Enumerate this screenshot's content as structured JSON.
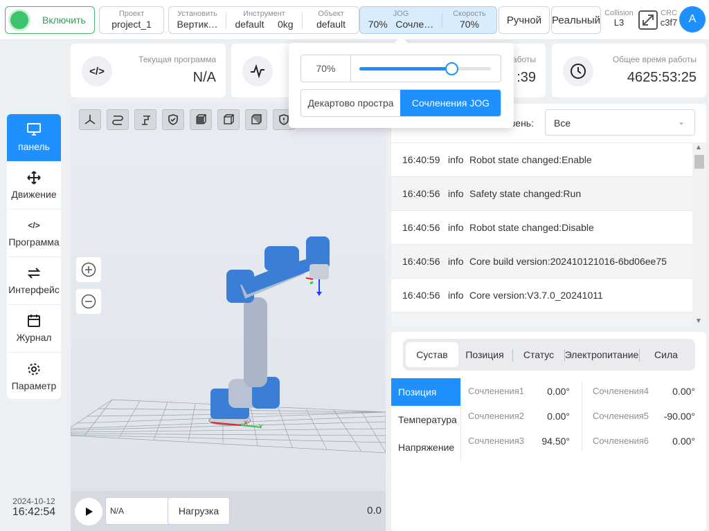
{
  "topbar": {
    "enable_label": "Включить",
    "project": {
      "label": "Проект",
      "value": "project_1"
    },
    "install": {
      "label": "Установить",
      "value": "Вертик…"
    },
    "tool": {
      "label": "Инструмент",
      "value": "default",
      "weight": "0kg"
    },
    "object": {
      "label": "Объект",
      "value": "default"
    },
    "jog": {
      "label": "JOG",
      "value": "70%",
      "mode": "Сочле…"
    },
    "speed": {
      "label": "Скорость",
      "value": "70%"
    },
    "manual_label": "Ручной",
    "real_label": "Реальный",
    "collision": {
      "label": "Collision",
      "value": "L3"
    },
    "crc": {
      "label": "CRC",
      "value": "c3f7"
    },
    "avatar_letter": "A"
  },
  "cards": {
    "program": {
      "icon": "</>",
      "title": "Текущая программа",
      "value": "N/A"
    },
    "runtime": {
      "title_fragment": "аботы",
      "value_fragment": ":39"
    },
    "total": {
      "title": "Общее время работы",
      "value": "4625:53:25"
    }
  },
  "sidebar": {
    "items": [
      {
        "label": "панель",
        "icon": "monitor-icon"
      },
      {
        "label": "Движение",
        "icon": "move-icon"
      },
      {
        "label": "Программа",
        "icon": "code-icon"
      },
      {
        "label": "Интерфейс",
        "icon": "swap-icon"
      },
      {
        "label": "Журнал",
        "icon": "calendar-icon"
      },
      {
        "label": "Параметр",
        "icon": "gear-icon"
      }
    ]
  },
  "datetime": {
    "date": "2024-10-12",
    "time": "16:42:54"
  },
  "viewport": {
    "axis_x_label": "X",
    "axis_y_label": "Y"
  },
  "playbar": {
    "program": "N/A",
    "load_label": "Нагрузка",
    "speed": "0.0"
  },
  "log": {
    "level_label_fragment": "вень:",
    "level_value": "Все",
    "rows": [
      {
        "time": "16:40:59",
        "level": "info",
        "msg": "Robot state changed:Enable"
      },
      {
        "time": "16:40:56",
        "level": "info",
        "msg": "Safety state changed:Run"
      },
      {
        "time": "16:40:56",
        "level": "info",
        "msg": "Robot state changed:Disable"
      },
      {
        "time": "16:40:56",
        "level": "info",
        "msg": "Core build version:202410121016-6bd06ee75"
      },
      {
        "time": "16:40:56",
        "level": "info",
        "msg": "Core version:V3.7.0_20241011"
      }
    ]
  },
  "joints": {
    "tabs": [
      "Сустав",
      "Позиция",
      "Статус",
      "Электропитание",
      "Сила"
    ],
    "left_tabs": [
      "Позиция",
      "Температура",
      "Напряжение"
    ],
    "values": [
      {
        "name": "Сочленения1",
        "value": "0.00°"
      },
      {
        "name": "Сочленения2",
        "value": "0.00°"
      },
      {
        "name": "Сочленения3",
        "value": "94.50°"
      },
      {
        "name": "Сочленения4",
        "value": "0.00°"
      },
      {
        "name": "Сочленения5",
        "value": "-90.00°"
      },
      {
        "name": "Сочленения6",
        "value": "0.00°"
      }
    ]
  },
  "jog_popup": {
    "percent": "70%",
    "slider_fraction": 0.7,
    "modes": [
      "Декартово простра",
      "Сочленения JOG"
    ]
  },
  "colors": {
    "accent": "#1e90ff",
    "enable": "#3cc36b",
    "robot": "#3a7fd5"
  }
}
